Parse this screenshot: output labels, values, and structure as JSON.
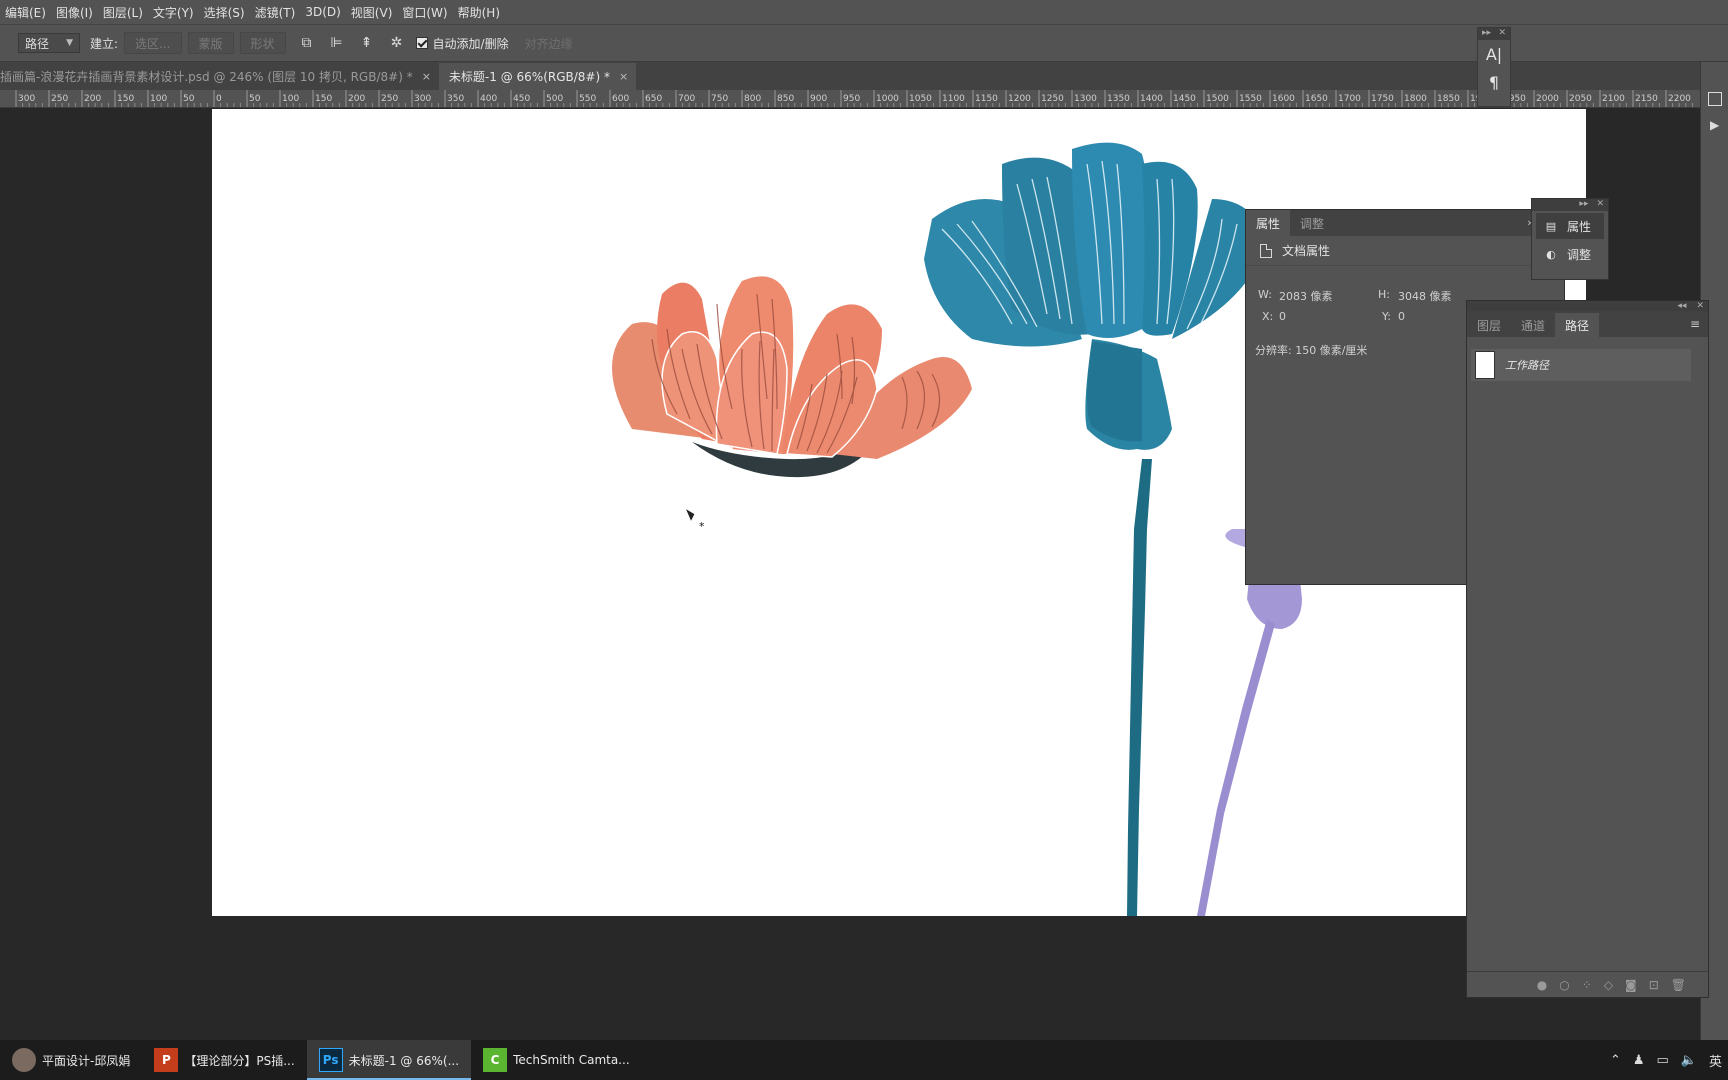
{
  "menubar": {
    "items": [
      "编辑(E)",
      "图像(I)",
      "图层(L)",
      "文字(Y)",
      "选择(S)",
      "滤镜(T)",
      "3D(D)",
      "视图(V)",
      "窗口(W)",
      "帮助(H)"
    ]
  },
  "options": {
    "mode_value": "路径",
    "build_label": "建立:",
    "selection_btn": "选区...",
    "mask_btn": "蒙版",
    "shape_btn": "形状",
    "auto_add_delete": "自动添加/删除",
    "align_edges": "对齐边缘"
  },
  "tabs": [
    {
      "label": "插画篇-浪漫花卉插画背景素材设计.psd @ 246% (图层 10 拷贝, RGB/8#) *",
      "close": "×"
    },
    {
      "label": "未标题-1 @ 66%(RGB/8#) *",
      "close": "×"
    }
  ],
  "ruler": {
    "labels": [
      "300",
      "250",
      "200",
      "150",
      "100",
      "50",
      "0",
      "50",
      "100",
      "150",
      "200",
      "250",
      "300",
      "350",
      "400",
      "450",
      "500",
      "550",
      "600",
      "650",
      "700",
      "750",
      "800",
      "850",
      "900",
      "950",
      "1000",
      "1050",
      "1100",
      "1150",
      "1200",
      "1250",
      "1300",
      "1350",
      "1400",
      "1450",
      "1500",
      "1550",
      "1600",
      "1650",
      "1700",
      "1750",
      "1800",
      "1850",
      "1900",
      "1950",
      "2000",
      "2050",
      "2100",
      "2150",
      "2200"
    ]
  },
  "mini_char_panel": {
    "char_icon": "A|",
    "para_icon": "¶"
  },
  "properties_panel": {
    "tab_properties": "属性",
    "tab_adjust": "调整",
    "doc_title": "文档属性",
    "w_label": "W:",
    "w_value": "2083 像素",
    "h_label": "H:",
    "h_value": "3048 像素",
    "x_label": "X:",
    "x_value": "0",
    "y_label": "Y:",
    "y_value": "0",
    "resolution": "分辨率: 150 像素/厘米"
  },
  "mini_pa_panel": {
    "props": "属性",
    "adjust": "调整"
  },
  "paths_panel": {
    "tab_layers": "图层",
    "tab_channels": "通道",
    "tab_paths": "路径",
    "work_path": "工作路径"
  },
  "taskbar": {
    "items": [
      {
        "label": "平面设计-邱凤娟"
      },
      {
        "label": "【理论部分】PS插..."
      },
      {
        "label": "未标题-1 @ 66%(..."
      },
      {
        "label": "TechSmith Camta..."
      }
    ],
    "ime": "英"
  },
  "colors": {
    "ps_panel": "#535353",
    "ps_dark": "#282828",
    "coral": "#e98a70",
    "teal": "#2a7f9e",
    "lavender": "#a497d6"
  }
}
